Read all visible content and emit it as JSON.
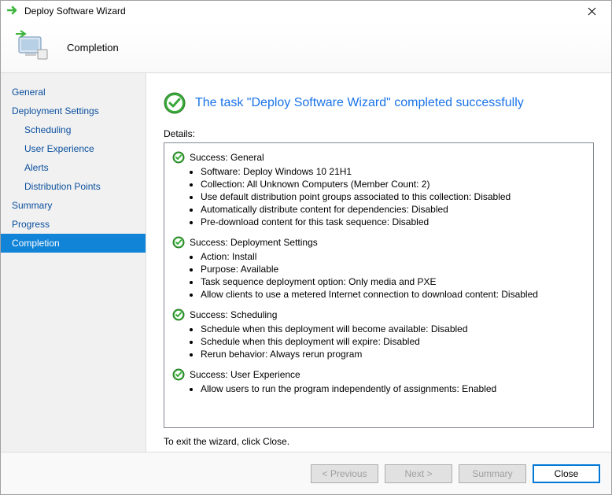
{
  "window": {
    "title": "Deploy Software Wizard"
  },
  "header": {
    "page": "Completion"
  },
  "sidebar": {
    "items": [
      {
        "label": "General",
        "child": false,
        "selected": false
      },
      {
        "label": "Deployment Settings",
        "child": false,
        "selected": false
      },
      {
        "label": "Scheduling",
        "child": true,
        "selected": false
      },
      {
        "label": "User Experience",
        "child": true,
        "selected": false
      },
      {
        "label": "Alerts",
        "child": true,
        "selected": false
      },
      {
        "label": "Distribution Points",
        "child": true,
        "selected": false
      },
      {
        "label": "Summary",
        "child": false,
        "selected": false
      },
      {
        "label": "Progress",
        "child": false,
        "selected": false
      },
      {
        "label": "Completion",
        "child": false,
        "selected": true
      }
    ]
  },
  "main": {
    "success_message": "The task \"Deploy Software Wizard\" completed successfully",
    "details_label": "Details:",
    "exit_text": "To exit the wizard, click Close.",
    "sections": [
      {
        "title": "Success: General",
        "items": [
          "Software: Deploy Windows 10 21H1",
          "Collection: All Unknown Computers (Member Count: 2)",
          "Use default distribution point groups associated to this collection: Disabled",
          "Automatically distribute content for dependencies: Disabled",
          "Pre-download content for this task sequence: Disabled"
        ]
      },
      {
        "title": "Success: Deployment Settings",
        "items": [
          "Action: Install",
          "Purpose: Available",
          "Task sequence deployment option: Only media and PXE",
          "Allow clients to use a metered Internet connection to download content: Disabled"
        ]
      },
      {
        "title": "Success: Scheduling",
        "items": [
          "Schedule when this deployment will become available: Disabled",
          "Schedule when this deployment will expire: Disabled",
          "Rerun behavior: Always rerun program"
        ]
      },
      {
        "title": "Success: User Experience",
        "items": [
          "Allow users to run the program independently of assignments: Enabled"
        ]
      }
    ]
  },
  "footer": {
    "previous": "< Previous",
    "next": "Next >",
    "summary": "Summary",
    "close": "Close"
  }
}
